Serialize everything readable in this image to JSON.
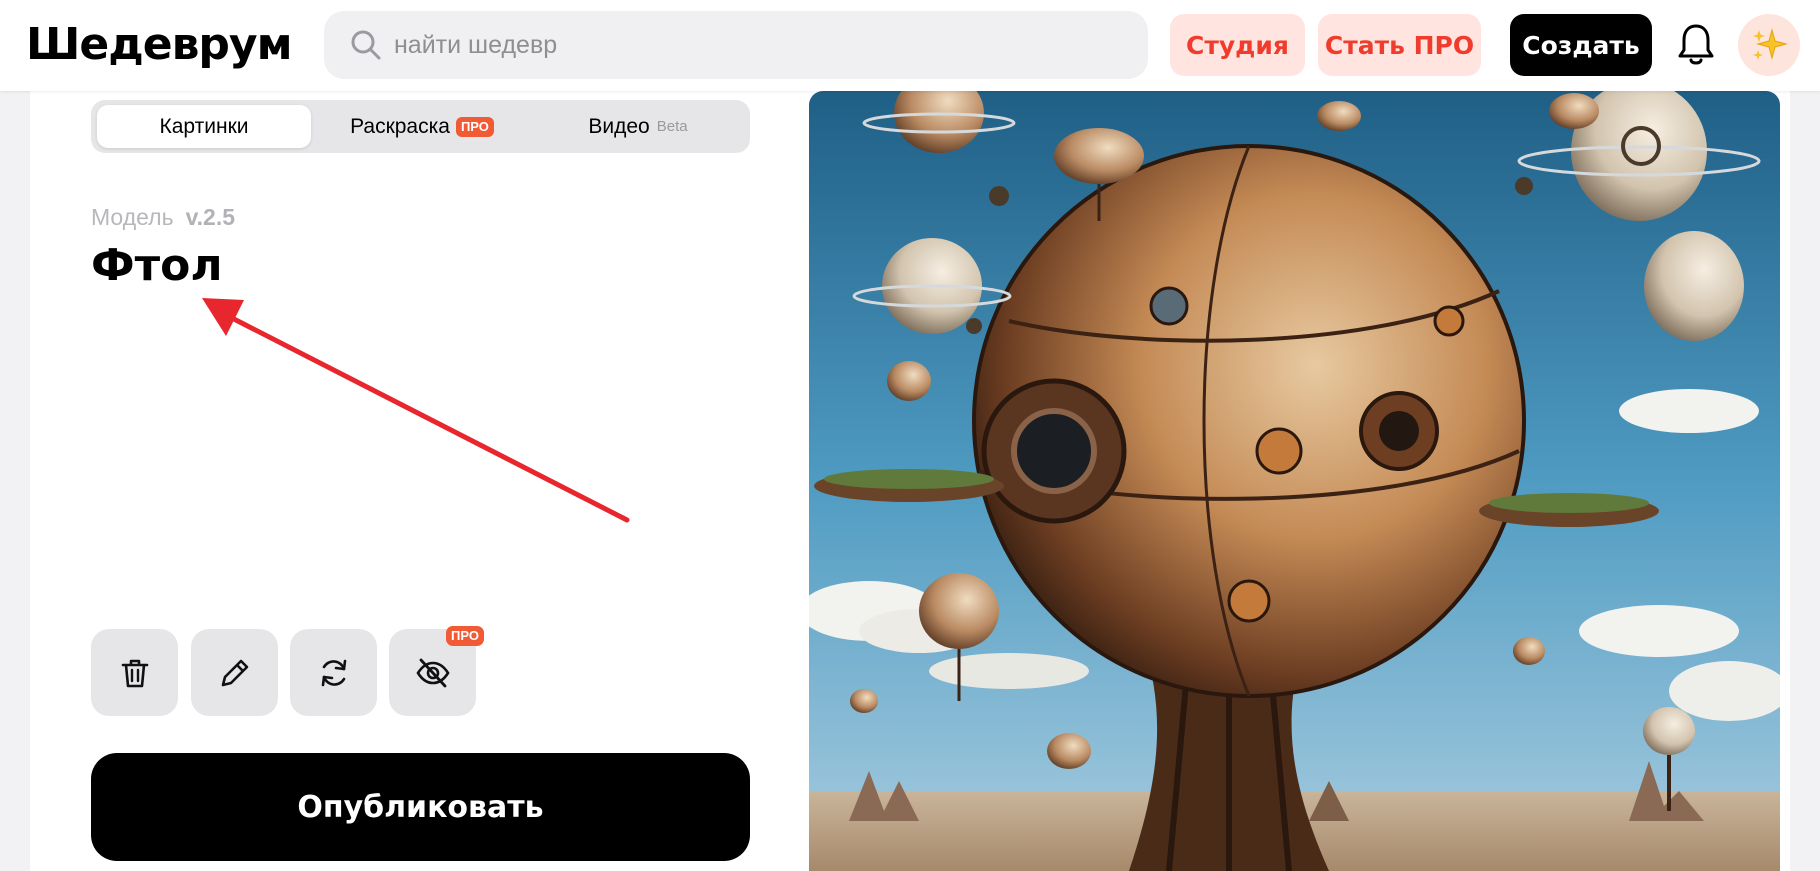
{
  "header": {
    "logo": "Шедеврум",
    "search_placeholder": "найти шедевр",
    "studio_label": "Студия",
    "pro_label": "Стать ПРО",
    "create_label": "Создать",
    "avatar_emoji": "✨"
  },
  "tabs": [
    {
      "label": "Картинки",
      "active": true
    },
    {
      "label": "Раскраска",
      "badge": "ПРО"
    },
    {
      "label": "Видео",
      "badge": "Beta"
    }
  ],
  "model": {
    "label": "Модель",
    "version": "v.2.5",
    "name": "Фтол"
  },
  "actions": {
    "hide_badge": "ПРО"
  },
  "publish_label": "Опубликовать",
  "colors": {
    "accent": "#f03c2d",
    "accent_bg": "#ffe4df",
    "arrow": "#e8262e",
    "pro_badge": "#f05a35"
  }
}
